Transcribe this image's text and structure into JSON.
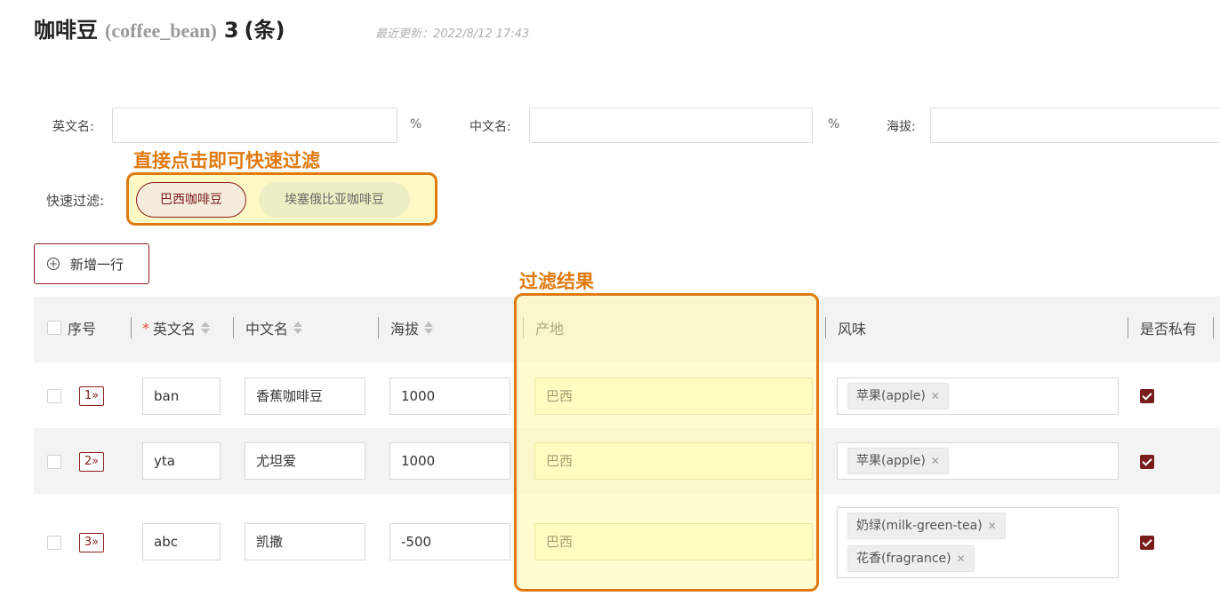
{
  "header": {
    "title": "咖啡豆",
    "code": "(coffee_bean)",
    "count": "3",
    "unit": "(条)",
    "updated": "最近更新：2022/8/12 17:43"
  },
  "filters": {
    "english_name_label": "英文名:",
    "english_name_value": "",
    "english_name_suffix": "%",
    "chinese_name_label": "中文名:",
    "chinese_name_value": "",
    "chinese_name_suffix": "%",
    "altitude_label": "海拔:",
    "altitude_value": ""
  },
  "quick_filter": {
    "label": "快速过滤:",
    "chips": [
      {
        "label": "巴西咖啡豆",
        "active": true
      },
      {
        "label": "埃塞俄比亚咖啡豆",
        "active": false
      }
    ]
  },
  "annotations": {
    "quick_filter_note": "直接点击即可快速过滤",
    "result_note": "过滤结果"
  },
  "toolbar": {
    "add_row_label": "新增一行"
  },
  "table": {
    "columns": {
      "index": "序号",
      "english_name": "英文名",
      "chinese_name": "中文名",
      "altitude": "海拔",
      "origin": "产地",
      "flavor": "风味",
      "private": "是否私有"
    },
    "rows": [
      {
        "index": "1",
        "english_name": "ban",
        "chinese_name": "香蕉咖啡豆",
        "altitude": "1000",
        "origin": "巴西",
        "flavors": [
          "苹果(apple)"
        ],
        "private": true
      },
      {
        "index": "2",
        "english_name": "yta",
        "chinese_name": "尤坦爱",
        "altitude": "1000",
        "origin": "巴西",
        "flavors": [
          "苹果(apple)"
        ],
        "private": true
      },
      {
        "index": "3",
        "english_name": "abc",
        "chinese_name": "凯撒",
        "altitude": "-500",
        "origin": "巴西",
        "flavors": [
          "奶绿(milk-green-tea)",
          "花香(fragrance)"
        ],
        "private": true
      }
    ]
  },
  "colors": {
    "accent": "#7b1c1c",
    "annotation": "#e07a10",
    "highlight": "#fdf9c4"
  }
}
